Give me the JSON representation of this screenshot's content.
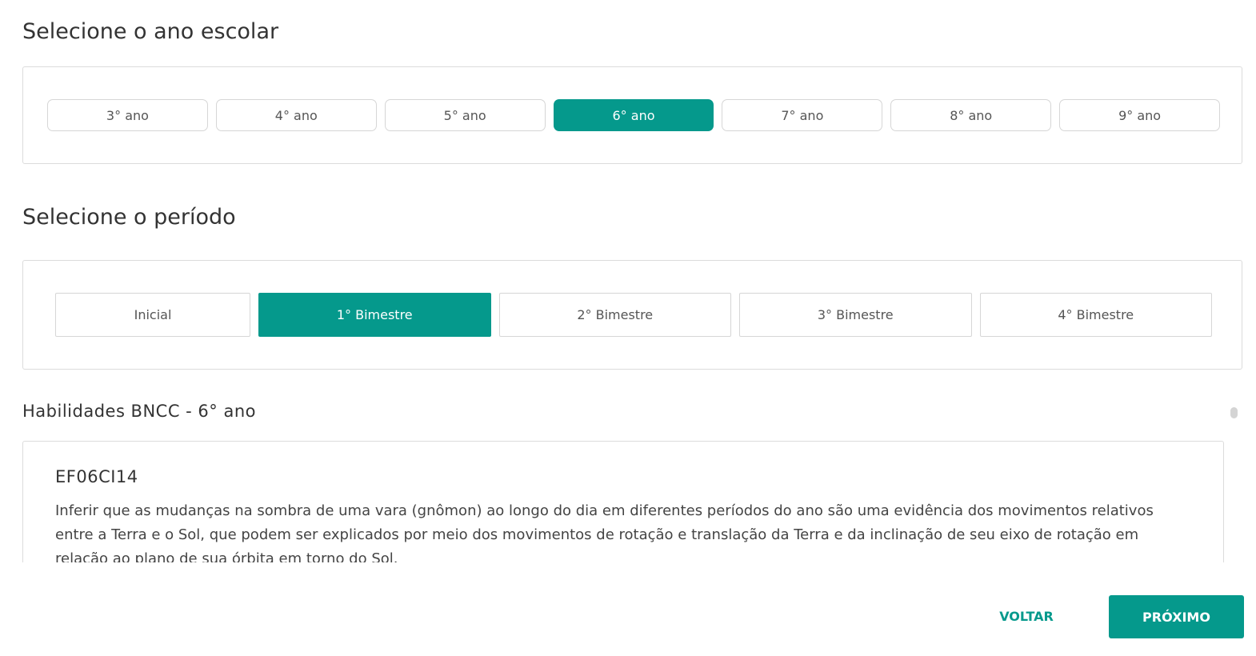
{
  "year_section": {
    "title": "Selecione o ano escolar",
    "options": [
      {
        "label": "3° ano",
        "selected": false
      },
      {
        "label": "4° ano",
        "selected": false
      },
      {
        "label": "5° ano",
        "selected": false
      },
      {
        "label": "6° ano",
        "selected": true
      },
      {
        "label": "7° ano",
        "selected": false
      },
      {
        "label": "8° ano",
        "selected": false
      },
      {
        "label": "9° ano",
        "selected": false
      }
    ]
  },
  "period_section": {
    "title": "Selecione o período",
    "options": [
      {
        "label": "Inicial",
        "selected": false
      },
      {
        "label": "1° Bimestre",
        "selected": true
      },
      {
        "label": "2° Bimestre",
        "selected": false
      },
      {
        "label": "3° Bimestre",
        "selected": false
      },
      {
        "label": "4° Bimestre",
        "selected": false
      }
    ]
  },
  "skills_section": {
    "title": "Habilidades BNCC - 6° ano",
    "items": [
      {
        "code": "EF06CI14",
        "description": "Inferir que as mudanças na sombra de uma vara (gnômon) ao longo do dia em diferentes períodos do ano são uma evidência dos movimentos relativos entre a Terra e o Sol, que podem ser explicados por meio dos movimentos de rotação e translação da Terra e da inclinação de seu eixo de rotação em relação ao plano de sua órbita em torno do Sol."
      }
    ]
  },
  "footer": {
    "back_label": "VOLTAR",
    "next_label": "PRÓXIMO"
  },
  "colors": {
    "accent": "#05998c",
    "border": "#dcdcdc",
    "text": "#333333"
  }
}
